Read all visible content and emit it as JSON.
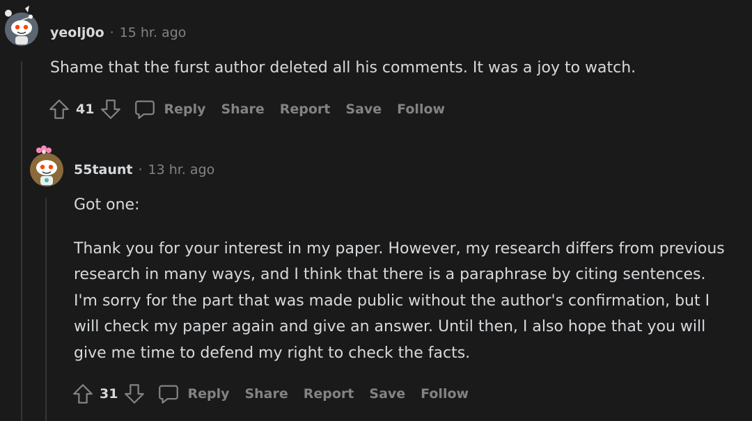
{
  "comments": [
    {
      "username": "yeolj0o",
      "separator": "·",
      "time": "15 hr. ago",
      "paragraphs": [
        "Shame that the furst author deleted all his comments. It was a joy to watch."
      ],
      "score": "41",
      "actions": {
        "reply": "Reply",
        "share": "Share",
        "report": "Report",
        "save": "Save",
        "follow": "Follow"
      }
    },
    {
      "username": "55taunt",
      "separator": "·",
      "time": "13 hr. ago",
      "paragraphs": [
        "Got one:",
        "Thank you for your interest in my paper. However, my research differs from previous research in many ways, and I think that there is a paraphrase by citing sentences. I'm sorry for the part that was made public without the author's confirmation, but I will check my paper again and give an answer. Until then, I also hope that you will give me time to defend my right to check the facts."
      ],
      "score": "31",
      "actions": {
        "reply": "Reply",
        "share": "Share",
        "report": "Report",
        "save": "Save",
        "follow": "Follow"
      }
    }
  ],
  "colors": {
    "background": "#1a1a1b",
    "text": "#d7dadc",
    "muted": "#818384",
    "thread_line": "#343536"
  },
  "icons": [
    "upvote-icon",
    "downvote-icon",
    "reply-bubble-icon",
    "snoo-avatar-icon"
  ]
}
